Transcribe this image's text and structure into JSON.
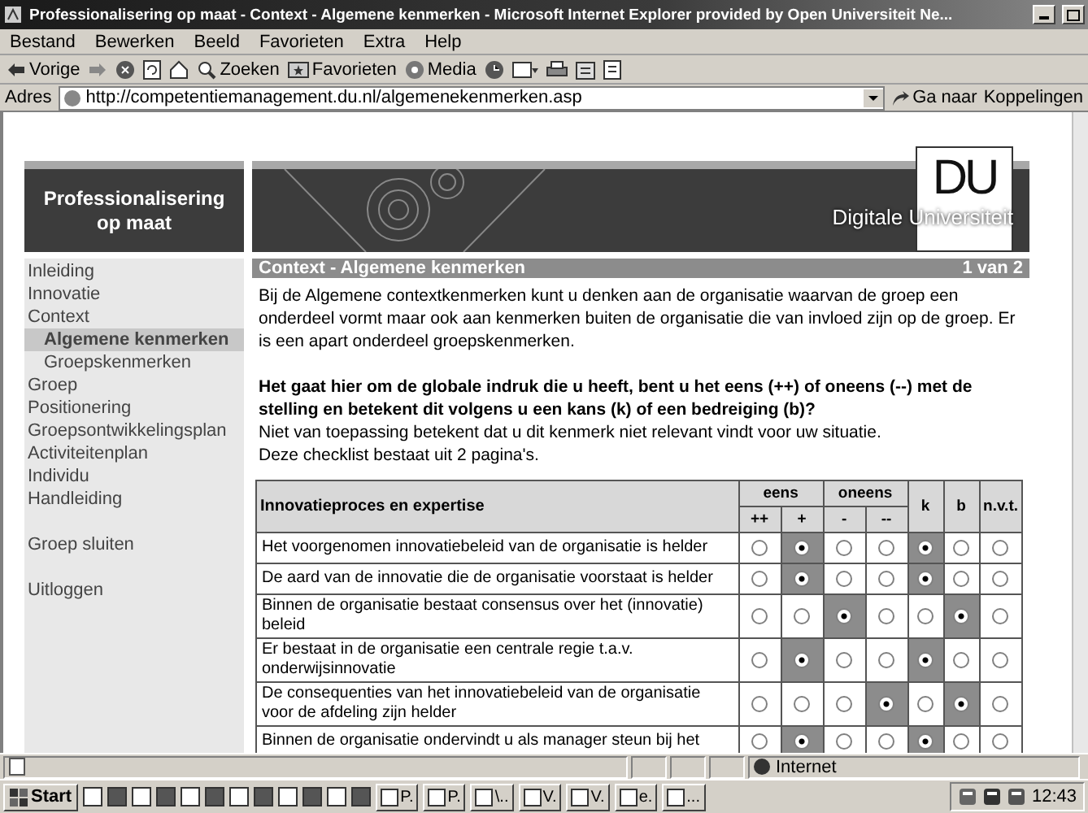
{
  "window": {
    "title": "Professionalisering  op maat - Context - Algemene kenmerken - Microsoft Internet Explorer provided by Open Universiteit Ne..."
  },
  "menu": [
    "Bestand",
    "Bewerken",
    "Beeld",
    "Favorieten",
    "Extra",
    "Help"
  ],
  "toolbar": [
    {
      "kind": "back",
      "label": "Vorige"
    },
    {
      "kind": "forward"
    },
    {
      "kind": "stop"
    },
    {
      "kind": "refresh"
    },
    {
      "kind": "home"
    },
    {
      "kind": "search",
      "label": "Zoeken"
    },
    {
      "kind": "favorites",
      "label": "Favorieten"
    },
    {
      "kind": "media",
      "label": "Media"
    },
    {
      "kind": "history"
    },
    {
      "kind": "mail"
    },
    {
      "kind": "print"
    },
    {
      "kind": "edit"
    },
    {
      "kind": "discuss"
    }
  ],
  "address": {
    "label": "Adres",
    "url": "http://competentiemanagement.du.nl/algemenekenmerken.asp",
    "go": "Ga naar",
    "links": "Koppelingen"
  },
  "page": {
    "banner_title": "Professionalisering op maat",
    "logo_mark": "DU",
    "logo_text": "Digitale Universiteit",
    "nav": [
      {
        "label": "Inleiding",
        "selected": false
      },
      {
        "label": "Innovatie",
        "selected": false
      },
      {
        "label": "Context",
        "selected": false,
        "children": [
          {
            "label": "Algemene kenmerken",
            "selected": true
          },
          {
            "label": "Groepskenmerken",
            "selected": false
          }
        ]
      },
      {
        "label": "Groep",
        "selected": false
      },
      {
        "label": "Positionering",
        "selected": false
      },
      {
        "label": "Groepsontwikkelingsplan",
        "selected": false
      },
      {
        "label": "Activiteitenplan",
        "selected": false
      },
      {
        "label": "Individu",
        "selected": false
      },
      {
        "label": "Handleiding",
        "selected": false
      }
    ],
    "nav_actions": [
      "Groep sluiten",
      "Uitloggen"
    ],
    "section_title": "Context - Algemene kenmerken",
    "page_counter": "1 van 2",
    "intro": "Bij de Algemene contextkenmerken kunt u denken aan de organisatie waarvan de groep een onderdeel vormt maar ook aan kenmerken buiten de organisatie die van invloed zijn op de groep. Er is een apart onderdeel groepskenmerken.",
    "question": "Het gaat hier om de globale indruk die u heeft, bent u het eens (++) of oneens (--) met de stelling en betekent dit volgens u een kans (k) of een bedreiging (b)?",
    "notes": [
      "Niet van toepassing betekent dat u dit kenmerk niet relevant vindt voor uw situatie.",
      "Deze checklist bestaat uit 2 pagina's."
    ],
    "table": {
      "heading": "Innovatieproces en expertise",
      "groups": [
        {
          "label": "eens",
          "columns": [
            "++",
            "+"
          ]
        },
        {
          "label": "oneens",
          "columns": [
            "-",
            "--"
          ]
        },
        {
          "label": "k"
        },
        {
          "label": "b"
        },
        {
          "label": "n.v.t."
        }
      ],
      "rows": [
        {
          "statement": "Het voorgenomen innovatiebeleid van de organisatie is helder",
          "options": [
            {
              "selected": false
            },
            {
              "selected": true
            },
            {
              "selected": false
            },
            {
              "selected": false
            },
            {
              "selected": true
            },
            {
              "selected": false
            },
            {
              "selected": false
            }
          ]
        },
        {
          "statement": "De aard van de innovatie die de organisatie voorstaat is helder",
          "options": [
            {
              "selected": false
            },
            {
              "selected": true
            },
            {
              "selected": false
            },
            {
              "selected": false
            },
            {
              "selected": true
            },
            {
              "selected": false
            },
            {
              "selected": false
            }
          ]
        },
        {
          "statement": "Binnen de organisatie bestaat consensus over het (innovatie) beleid",
          "options": [
            {
              "selected": false
            },
            {
              "selected": false
            },
            {
              "selected": true
            },
            {
              "selected": false
            },
            {
              "selected": false
            },
            {
              "selected": true
            },
            {
              "selected": false
            }
          ]
        },
        {
          "statement": "Er bestaat in de organisatie een centrale regie t.a.v. onderwijsinnovatie",
          "options": [
            {
              "selected": false
            },
            {
              "selected": true
            },
            {
              "selected": false
            },
            {
              "selected": false
            },
            {
              "selected": true
            },
            {
              "selected": false
            },
            {
              "selected": false
            }
          ]
        },
        {
          "statement": "De consequenties van het innovatiebeleid van de organisatie voor de afdeling zijn helder",
          "options": [
            {
              "selected": false
            },
            {
              "selected": false
            },
            {
              "selected": false
            },
            {
              "selected": true
            },
            {
              "selected": false
            },
            {
              "selected": true
            },
            {
              "selected": false
            }
          ]
        },
        {
          "statement": "Binnen de organisatie ondervindt u als manager steun bij het",
          "options": [
            {
              "selected": false
            },
            {
              "selected": true
            },
            {
              "selected": false
            },
            {
              "selected": false
            },
            {
              "selected": true
            },
            {
              "selected": false
            },
            {
              "selected": false
            }
          ]
        }
      ]
    }
  },
  "status_bar": {
    "zone": "Internet"
  },
  "taskbar": {
    "start": "Start",
    "tasks": [
      "P.",
      "P.",
      "\\..",
      "V.",
      "V.",
      "e.",
      "..."
    ],
    "clock": "12:43"
  }
}
